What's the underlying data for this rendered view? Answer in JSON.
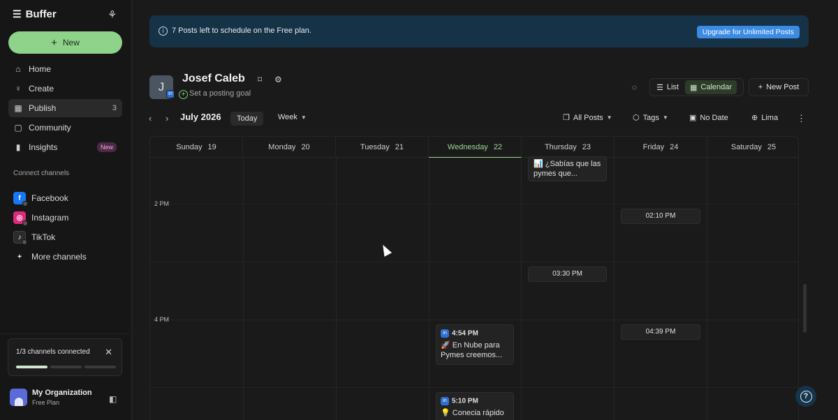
{
  "sidebar": {
    "brand": "Buffer",
    "new_label": "New",
    "nav": [
      {
        "label": "Home",
        "icon": "home-icon"
      },
      {
        "label": "Create",
        "icon": "bulb-icon"
      },
      {
        "label": "Publish",
        "icon": "calendar-icon",
        "count": "3"
      },
      {
        "label": "Community",
        "icon": "chat-icon"
      },
      {
        "label": "Insights",
        "icon": "chart-icon",
        "badge": "New"
      }
    ],
    "connect_label": "Connect channels",
    "channels": [
      {
        "label": "Facebook"
      },
      {
        "label": "Instagram"
      },
      {
        "label": "TikTok"
      },
      {
        "label": "More channels"
      }
    ],
    "connected_card": {
      "text": "1/3 channels connected",
      "progress": 0.33
    },
    "org": {
      "name": "My Organization",
      "plan": "Free Plan"
    }
  },
  "banner": {
    "message": "7 Posts left to schedule on the Free plan.",
    "upgrade_label": "Upgrade for Unlimited Posts"
  },
  "profile": {
    "initial": "J",
    "name": "Josef Caleb",
    "goal": "Set a posting goal"
  },
  "view": {
    "list_label": "List",
    "calendar_label": "Calendar",
    "active": "Calendar",
    "new_post_label": "New Post"
  },
  "toolbar": {
    "month": "July 2026",
    "today_label": "Today",
    "range_label": "Week",
    "filter_label": "All Posts",
    "tags_label": "Tags",
    "nodate_label": "No Date",
    "timezone_label": "Lima"
  },
  "calendar": {
    "days": [
      {
        "name": "Sunday",
        "num": "19"
      },
      {
        "name": "Monday",
        "num": "20"
      },
      {
        "name": "Tuesday",
        "num": "21"
      },
      {
        "name": "Wednesday",
        "num": "22",
        "today": true
      },
      {
        "name": "Thursday",
        "num": "23"
      },
      {
        "name": "Friday",
        "num": "24"
      },
      {
        "name": "Saturday",
        "num": "25"
      }
    ],
    "hour_labels": [
      "2 PM",
      "4 PM"
    ],
    "posts": [
      {
        "day": "Thursday",
        "time": "",
        "text": "📊 ¿Sabías que las pymes que..."
      },
      {
        "day": "Friday",
        "time": "02:10 PM",
        "text": ""
      },
      {
        "day": "Thursday",
        "time": "03:30 PM",
        "text": ""
      },
      {
        "day": "Friday",
        "time": "04:39 PM",
        "text": ""
      },
      {
        "day": "Wednesday",
        "time": "4:54 PM",
        "text": "🚀 En Nube para Pymes creemos..."
      },
      {
        "day": "Wednesday",
        "time": "5:10 PM",
        "text": "💡 Conecia rápido"
      }
    ]
  },
  "colors": {
    "accent_green": "#8fd38a",
    "banner_bg": "#153247",
    "upgrade_blue": "#3b8be3",
    "linkedin_blue": "#2f6fd0"
  }
}
